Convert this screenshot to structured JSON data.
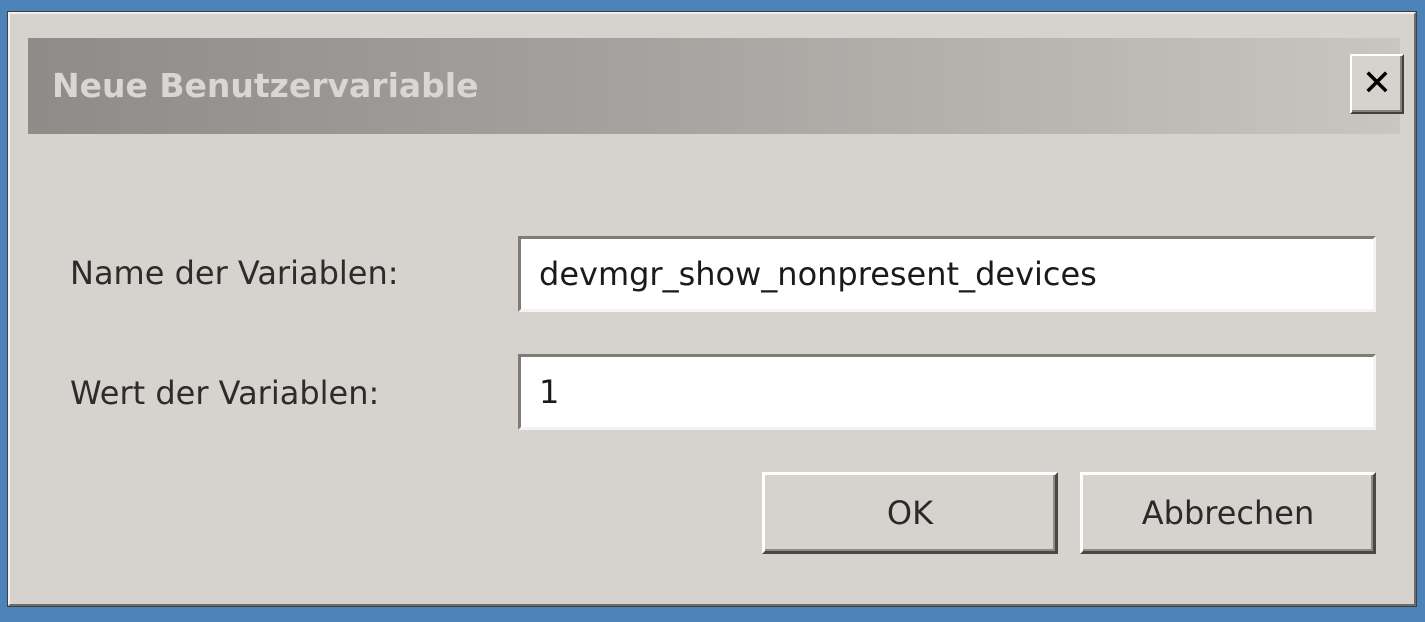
{
  "window": {
    "title": "Neue Benutzervariable",
    "close_label": "✕"
  },
  "form": {
    "name_label": "Name der Variablen:",
    "name_value": "devmgr_show_nonpresent_devices",
    "value_label": "Wert der Variablen:",
    "value_value": "1"
  },
  "buttons": {
    "ok_label": "OK",
    "cancel_label": "Abbrechen"
  },
  "colors": {
    "desktop": "#4d82b8",
    "dialog_face": "#d6d3ce"
  }
}
